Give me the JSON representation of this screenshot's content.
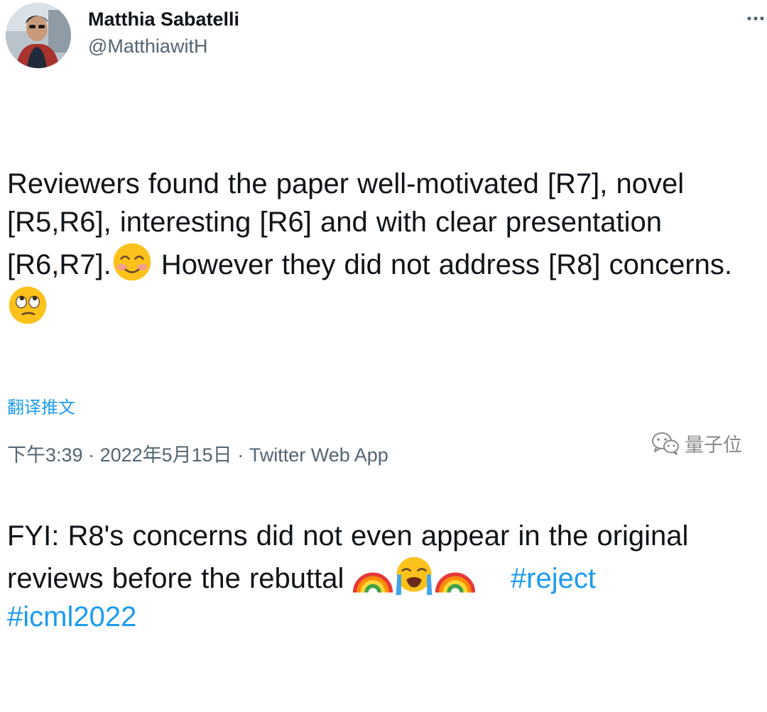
{
  "author": {
    "name": "Matthia Sabatelli",
    "handle": "@MatthiawitH"
  },
  "body": {
    "p1_text": "Reviewers found the paper well-motivated [R7], novel [R5,R6], interesting [R6] and with clear presentation [R6,R7].",
    "p1_emoji": "smiling-face-with-smiling-eyes",
    "p1_text2": " However they did not address [R8] concerns. ",
    "p1_emoji2": "face-with-rolling-eyes",
    "p2_text": "FYI: R8's concerns did not even appear in the original reviews before the rebuttal ",
    "p2_emojis": [
      "rainbow",
      "loudly-crying-face",
      "rainbow"
    ],
    "hashtags": [
      "#reject",
      "#icml2022"
    ]
  },
  "translate_label": "翻译推文",
  "meta": {
    "time": "下午3:39",
    "separator1": " · ",
    "date": "2022年5月15日",
    "separator2": " · ",
    "source": "Twitter Web App"
  },
  "watermark": {
    "icon": "wechat-icon",
    "text": "量子位"
  },
  "colors": {
    "link": "#1d9bf0",
    "secondary_text": "#536471",
    "primary_text": "#0f1419"
  }
}
